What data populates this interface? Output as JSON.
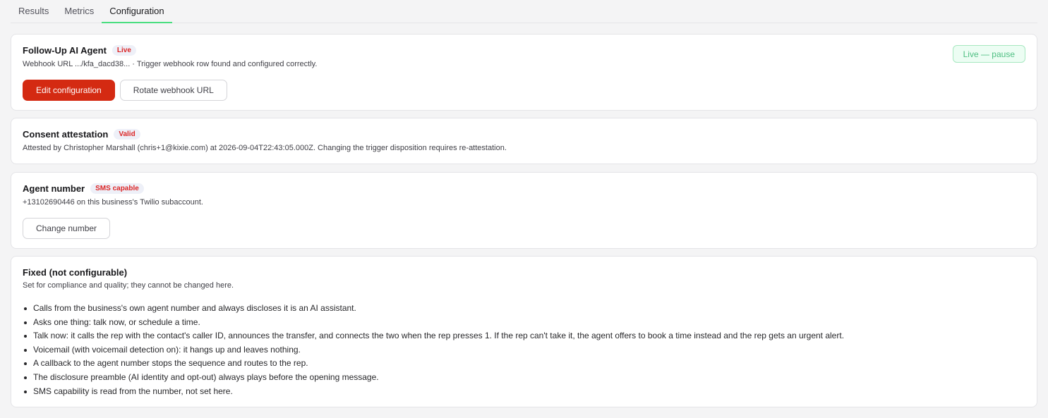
{
  "tabs": [
    {
      "label": "Results",
      "active": false
    },
    {
      "label": "Metrics",
      "active": false
    },
    {
      "label": "Configuration",
      "active": true
    }
  ],
  "agent": {
    "title": "Follow-Up AI Agent",
    "badge": "Live",
    "description": "Webhook URL .../kfa_dacd38... · Trigger webhook row found and configured correctly.",
    "status_button": "Live — pause",
    "edit_button": "Edit configuration",
    "rotate_button": "Rotate webhook URL"
  },
  "consent": {
    "title": "Consent attestation",
    "badge": "Valid",
    "description": "Attested by Christopher Marshall (chris+1@kixie.com) at 2026-09-04T22:43:05.000Z. Changing the trigger disposition requires re-attestation."
  },
  "number": {
    "title": "Agent number",
    "badge": "SMS capable",
    "description": "+13102690446 on this business's Twilio subaccount.",
    "change_button": "Change number"
  },
  "fixed": {
    "title": "Fixed (not configurable)",
    "description": "Set for compliance and quality; they cannot be changed here.",
    "items": [
      "Calls from the business's own agent number and always discloses it is an AI assistant.",
      "Asks one thing: talk now, or schedule a time.",
      "Talk now: it calls the rep with the contact's caller ID, announces the transfer, and connects the two when the rep presses 1. If the rep can't take it, the agent offers to book a time instead and the rep gets an urgent alert.",
      "Voicemail (with voicemail detection on): it hangs up and leaves nothing.",
      "A callback to the agent number stops the sequence and routes to the rep.",
      "The disclosure preamble (AI identity and opt-out) always plays before the opening message.",
      "SMS capability is read from the number, not set here."
    ]
  },
  "colors": {
    "primary": "#d42a12",
    "badge_text": "#dc2626",
    "live_green": "#4fbf83",
    "tab_underline": "#4ade80"
  }
}
